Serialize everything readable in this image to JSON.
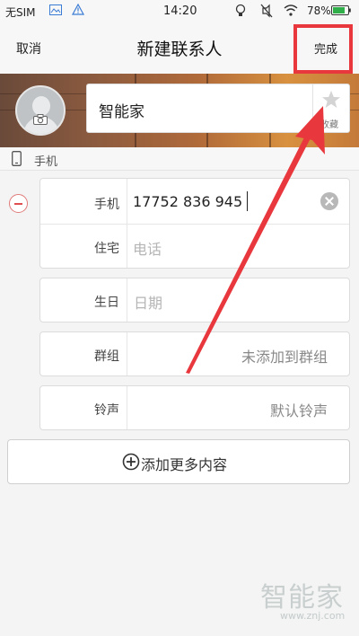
{
  "status_bar": {
    "carrier": "无SIM",
    "time": "14:20",
    "battery": "78%",
    "icons": [
      "gallery-icon",
      "warning-icon",
      "bulb-icon",
      "mute-icon",
      "wifi-icon",
      "battery-icon"
    ]
  },
  "title_bar": {
    "cancel": "取消",
    "title": "新建联系人",
    "done": "完成"
  },
  "contact": {
    "name": "智能家",
    "favorite_label": "收藏"
  },
  "phone_section": {
    "label": "手机"
  },
  "fields": {
    "mobile": {
      "label": "手机",
      "value": "17752 836 945"
    },
    "home": {
      "label": "住宅",
      "placeholder": "电话"
    },
    "birthday": {
      "label": "生日",
      "placeholder": "日期"
    },
    "group": {
      "label": "群组",
      "value": "未添加到群组"
    },
    "ringtone": {
      "label": "铃声",
      "value": "默认铃声"
    }
  },
  "add_more": "添加更多内容",
  "watermark": {
    "brand": "智能家",
    "url": "www.znj.com"
  },
  "colors": {
    "annotation_red": "#e8383d",
    "remove_red": "#e05050"
  }
}
